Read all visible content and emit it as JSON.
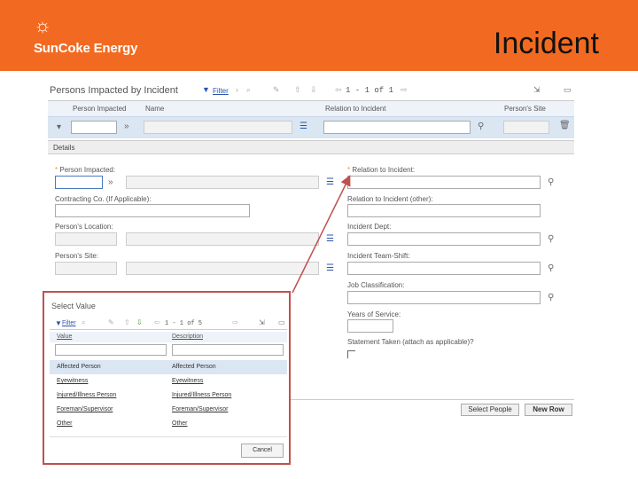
{
  "header": {
    "brand": "SunCoke Energy",
    "title": "Incident",
    "color": "#f26a21"
  },
  "section": {
    "title": "Persons Impacted by Incident",
    "filter_label": "Filter",
    "pager": "1 - 1 of 1"
  },
  "columns": [
    "Person Impacted",
    "Name",
    "Relation to Incident",
    "Person's Site"
  ],
  "details": {
    "bar_label": "Details",
    "left": {
      "person_impacted": "Person Impacted:",
      "contracting_co": "Contracting Co. (If Applicable):",
      "persons_location": "Person's Location:",
      "persons_site": "Person's Site:"
    },
    "right": {
      "relation": "Relation to Incident:",
      "relation_other": "Relation to Incident (other):",
      "incident_dept": "Incident Dept:",
      "incident_team_shift": "Incident Team-Shift:",
      "job_classification": "Job Classification:",
      "years_of_service": "Years of Service:",
      "statement_taken": "Statement Taken (attach as applicable)?"
    }
  },
  "buttons": {
    "select_people": "Select People",
    "new_row": "New Row"
  },
  "popup": {
    "title": "Select Value",
    "filter_label": "Filter",
    "pager": "1 - 1 of 5",
    "columns": [
      "Value",
      "Description"
    ],
    "rows": [
      {
        "value": "Affected Person",
        "description": "Affected Person"
      },
      {
        "value": "Eyewitness",
        "description": "Eyewitness"
      },
      {
        "value": "Injured/Illness Person",
        "description": "Injured/Illness Person"
      },
      {
        "value": "Foreman/Supervisor",
        "description": "Foreman/Supervisor"
      },
      {
        "value": "Other",
        "description": "Other"
      }
    ],
    "cancel": "Cancel",
    "border_color": "#c0504d"
  }
}
